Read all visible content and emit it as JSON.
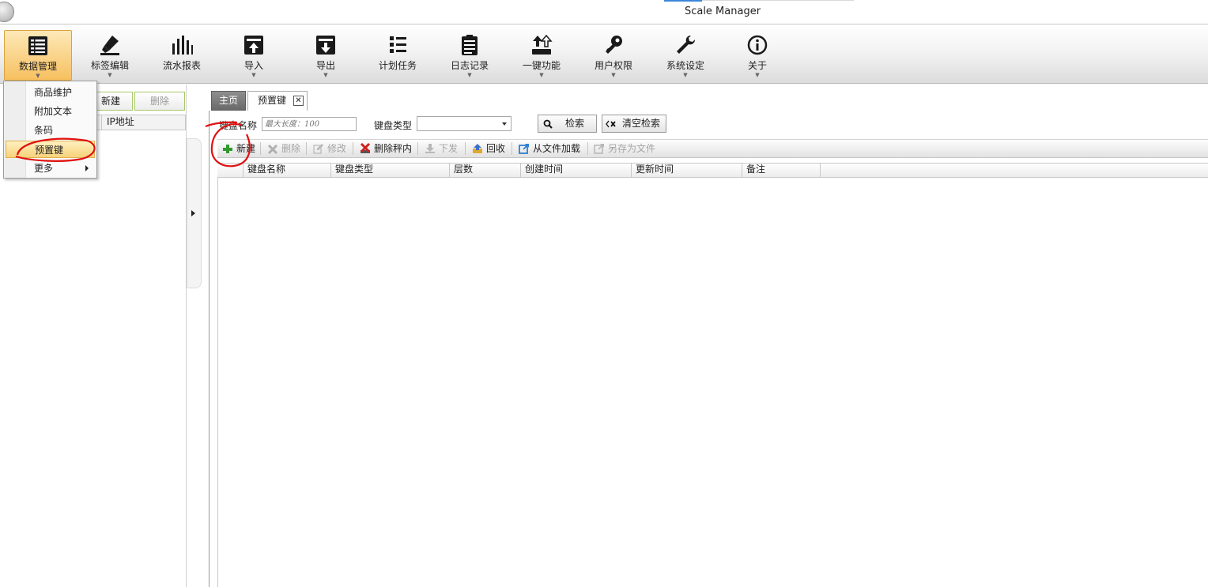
{
  "window": {
    "title": "Scale Manager"
  },
  "ribbon": {
    "buttons": [
      {
        "label": "数据管理",
        "icon": "database-list-icon"
      },
      {
        "label": "标签编辑",
        "icon": "highlighter-icon"
      },
      {
        "label": "流水报表",
        "icon": "bar-chart-icon"
      },
      {
        "label": "导入",
        "icon": "import-icon"
      },
      {
        "label": "导出",
        "icon": "export-icon"
      },
      {
        "label": "计划任务",
        "icon": "task-list-icon"
      },
      {
        "label": "日志记录",
        "icon": "log-clipboard-icon"
      },
      {
        "label": "一键功能",
        "icon": "one-key-upload-icon"
      },
      {
        "label": "用户权限",
        "icon": "key-icon"
      },
      {
        "label": "系统设定",
        "icon": "wrench-icon"
      },
      {
        "label": "关于",
        "icon": "info-icon"
      }
    ]
  },
  "data_menu": {
    "items": [
      {
        "label": "商品维护"
      },
      {
        "label": "附加文本"
      },
      {
        "label": "条码"
      },
      {
        "label": "预置键"
      },
      {
        "label": "更多"
      }
    ]
  },
  "left_panel": {
    "new_label": "新建",
    "delete_label": "删除",
    "ip_column": "IP地址"
  },
  "tabs": {
    "home": "主页",
    "preset": "预置键",
    "close_glyph": "✕"
  },
  "search": {
    "name_label": "键盘名称",
    "name_placeholder": "最大长度：100",
    "type_label": "键盘类型",
    "type_value": "",
    "search_label": "检索",
    "clear_label": "清空检索"
  },
  "toolbar": {
    "new": "新建",
    "delete": "删除",
    "edit": "修改",
    "delete_in_scale": "删除秤内",
    "send": "下发",
    "recall": "回收",
    "load_from_file": "从文件加载",
    "save_as_file": "另存为文件"
  },
  "grid": {
    "columns": [
      "键盘名称",
      "键盘类型",
      "层数",
      "创建时间",
      "更新时间",
      "备注"
    ]
  },
  "colors": {
    "accent_active": "#f7c060",
    "annotation_red": "#e01010",
    "panel_border_green": "#a8c86a"
  }
}
